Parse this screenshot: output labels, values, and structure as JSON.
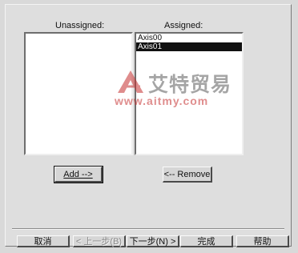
{
  "lists": {
    "unassigned_label": "Unassigned:",
    "assigned_label": "Assigned:",
    "unassigned_items": [],
    "assigned_items": [
      {
        "label": "Axis00",
        "selected": false
      },
      {
        "label": "Axis01",
        "selected": true
      }
    ]
  },
  "actions": {
    "add_label": "Add -->",
    "remove_label": "<-- Remove"
  },
  "footer": {
    "cancel_label": "取消",
    "back_label": "< 上一步(B)",
    "next_label": "下一步(N) >",
    "finish_label": "完成",
    "help_label": "帮助"
  },
  "watermark": {
    "brand": "艾特贸易",
    "url": "www.aitmy.com"
  }
}
